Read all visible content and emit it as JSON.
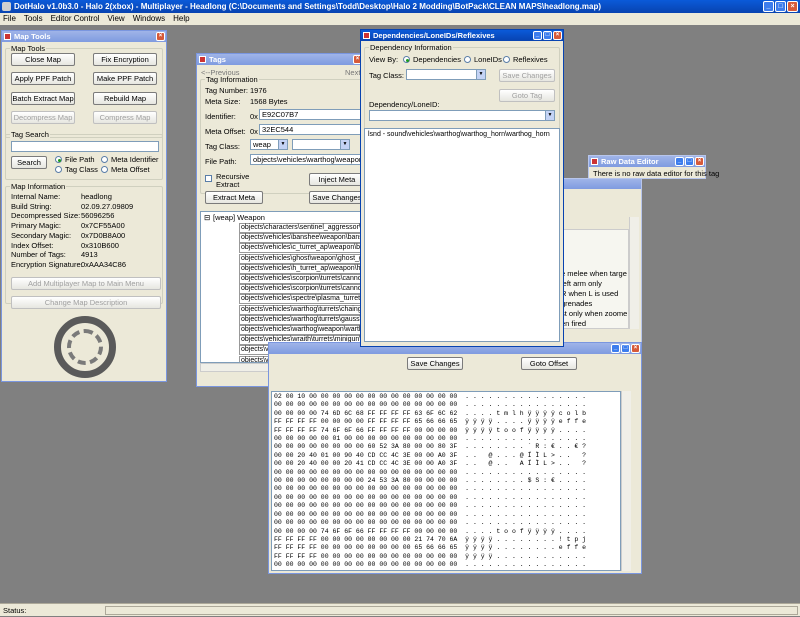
{
  "app": {
    "title": "DotHalo v1.0b3.0 - Halo 2(xbox) - Multiplayer - Headlong (C:\\Documents and Settings\\Todd\\Desktop\\Halo 2 Modding\\BotPack\\CLEAN MAPS\\headlong.map)"
  },
  "menu": [
    "File",
    "Tools",
    "Editor Control",
    "View",
    "Windows",
    "Help"
  ],
  "maptools": {
    "title": "Map Tools",
    "group_title": "Map Tools",
    "buttons": [
      "Close Map",
      "Fix Encryption",
      "Apply PPF Patch",
      "Make PPF Patch",
      "Batch Extract Map",
      "Rebuild Map",
      "Decompress Map",
      "Compress Map"
    ],
    "search_group": "Tag Search",
    "search_button": "Search",
    "search_options": [
      "File Path",
      "Meta Identifier",
      "Tag Class",
      "Meta Offset"
    ],
    "info_group": "Map Information",
    "info": [
      {
        "k": "Internal Name:",
        "v": "headlong"
      },
      {
        "k": "Build String:",
        "v": "02.09.27.09809"
      },
      {
        "k": "Decompressed Size:",
        "v": "56096256"
      },
      {
        "k": "Primary Magic:",
        "v": "0x7CF55A00"
      },
      {
        "k": "Secondary Magic:",
        "v": "0x7D0B8A00"
      },
      {
        "k": "Index Offset:",
        "v": "0x310B600"
      },
      {
        "k": "Number of Tags:",
        "v": "4913"
      },
      {
        "k": "Encryption Signature:",
        "v": "0xAAA34C86"
      }
    ],
    "add_mp_button": "Add Multiplayer Map to Main Menu",
    "change_desc_button": "Change Map Description"
  },
  "tags": {
    "title": "Tags",
    "prev": "<--Previous",
    "next": "Next",
    "group": "Tag Information",
    "tag_number_label": "Tag Number:",
    "tag_number": "1976",
    "meta_size_label": "Meta Size:",
    "meta_size": "1568 Bytes",
    "identifier_label": "Identifier:",
    "identifier_prefix": "0x",
    "identifier": "E92C07B7",
    "meta_offset_label": "Meta Offset:",
    "meta_offset_prefix": "0x",
    "meta_offset": "32EC544",
    "tag_class_label": "Tag Class:",
    "tag_class": "weap",
    "file_path_label": "File Path:",
    "file_path": "objects\\vehicles\\warthog\\weapon\\warth",
    "recursive_label": "Recursive Extract",
    "inject_button": "Inject Meta",
    "extract_button": "Extract Meta",
    "save_button": "Save Changes",
    "tree_root": "[weap] Weapon",
    "tree_items": [
      "objects\\characters\\sentinel_aggressor\\weap",
      "objects\\vehicles\\banshee\\weapon\\banshe",
      "objects\\vehicles\\c_turret_ap\\weapon\\ba",
      "objects\\vehicles\\ghost\\weapon\\ghost_g",
      "objects\\vehicles\\h_turret_ap\\weapon\\h_",
      "objects\\vehicles\\scorpion\\turrets\\cannon",
      "objects\\vehicles\\scorpion\\turrets\\cannon",
      "objects\\vehicles\\spectre\\plasma_turret\\",
      "objects\\vehicles\\warthog\\turrets\\chaingu",
      "objects\\vehicles\\warthog\\turrets\\gauss\\w",
      "objects\\vehicles\\warthog\\weapon\\wartho",
      "objects\\vehicles\\wraith\\turrets\\minigun\\m",
      "objects\\vehicles\\wraith\\turrets\\mortar\\mo",
      "objects\\vehicles\\wraith\\turrets\\mortar\\mo"
    ]
  },
  "deps": {
    "title": "Dependencies/LoneIDs/Reflexives",
    "group": "Dependency Information",
    "view_by": "View By:",
    "options": [
      "Dependencies",
      "LoneIDs",
      "Reflexives"
    ],
    "tag_class_label": "Tag Class:",
    "save_button": "Save Changes",
    "goto_button": "Goto Tag",
    "dep_label": "Dependency/LoneID:",
    "list": [
      "lsnd - sound\\vehicles\\warthog\\warthog_horn\\warthog_horn"
    ]
  },
  "rawdata": {
    "title": "Raw Data Editor",
    "text": "There is no raw data editor for this tag"
  },
  "meta": {
    "lines": [
      "e melee when targe",
      "left arm only",
      "R when L is used",
      "grenades",
      "st only when zoome",
      "en fired"
    ],
    "save_button": "Save Changes",
    "goto_button": "Goto Offset"
  },
  "hex": {
    "rows": [
      [
        "02 00 10 00 00 00 00 00 00 00 00 00 00 00 00 00",
        ". . . . . . . . . . . . . . . ."
      ],
      [
        "00 00 00 00 00 00 00 00 00 00 00 00 00 00 00 00",
        ". . . . . . . . . . . . . . . ."
      ],
      [
        "00 00 00 00 74 6D 6C 68 FF FF FF FF 63 6F 6C 62",
        ". . . . t m l h ÿ ÿ ÿ ÿ c o l b"
      ],
      [
        "FF FF FF FF 00 00 00 00 FF FF FF FF 65 66 66 65",
        "ÿ ÿ ÿ ÿ . . . . ÿ ÿ ÿ ÿ e f f e"
      ],
      [
        "FF FF FF FF 74 6F 6F 66 FF FF FF FF 00 00 00 00",
        "ÿ ÿ ÿ ÿ t o o f ÿ ÿ ÿ ÿ . . . ."
      ],
      [
        "00 00 00 00 00 01 00 00 00 00 00 00 00 00 00 00",
        ". . . . . . . . . . . . . . . ."
      ],
      [
        "00 00 00 00 00 00 00 00 60 52 3A 80 00 00 80 3F",
        ". . . . . . . . ` R : € . . € ?"
      ],
      [
        "00 00 20 40 01 00 90 40 CD CC 4C 3E 00 00 A0 3F",
        ". .   @ . . . @ Í Ì L > . .   ?"
      ],
      [
        "00 00 20 40 00 00 20 41 CD CC 4C 3E 00 00 A0 3F",
        ". .   @ . .   A Í Ì L > . .   ?"
      ],
      [
        "00 00 00 00 00 00 00 00 00 00 00 00 00 00 00 00",
        ". . . . . . . . . . . . . . . ."
      ],
      [
        "00 00 00 00 00 00 00 00 24 53 3A 80 00 00 00 00",
        ". . . . . . . . $ S : € . . . ."
      ],
      [
        "00 00 00 00 00 00 00 00 00 00 00 00 00 00 00 00",
        ". . . . . . . . . . . . . . . ."
      ],
      [
        "00 00 00 00 00 00 00 00 00 00 00 00 00 00 00 00",
        ". . . . . . . . . . . . . . . ."
      ],
      [
        "00 00 00 00 00 00 00 00 00 00 00 00 00 00 00 00",
        ". . . . . . . . . . . . . . . ."
      ],
      [
        "00 00 00 00 00 00 00 00 00 00 00 00 00 00 00 00",
        ". . . . . . . . . . . . . . . ."
      ],
      [
        "00 00 00 00 00 00 00 00 00 00 00 00 00 00 00 00",
        ". . . . . . . . . . . . . . . ."
      ],
      [
        "00 00 00 00 74 6F 6F 66 FF FF FF FF 00 00 00 00",
        ". . . . t o o f ÿ ÿ ÿ ÿ . . . ."
      ],
      [
        "FF FF FF FF 00 00 00 00 00 00 00 00 21 74 70 6A",
        "ÿ ÿ ÿ ÿ . . . . . . . . ! t p j"
      ],
      [
        "FF FF FF FF 00 00 00 00 00 00 00 00 65 66 66 65",
        "ÿ ÿ ÿ ÿ . . . . . . . . e f f e"
      ],
      [
        "FF FF FF FF 00 00 00 00 00 00 00 00 00 00 00 00",
        "ÿ ÿ ÿ ÿ . . . . . . . . . . . ."
      ],
      [
        "00 00 00 00 00 00 00 00 00 00 00 00 00 00 00 00",
        ". . . . . . . . . . . . . . . ."
      ]
    ]
  },
  "status": {
    "label": "Status:"
  }
}
